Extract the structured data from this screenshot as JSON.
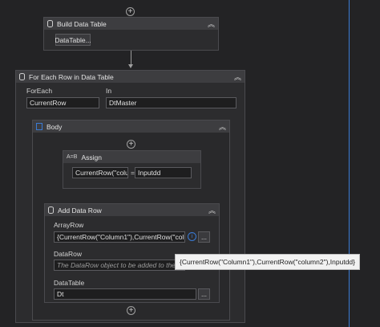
{
  "build_data_table": {
    "title": "Build Data Table",
    "button_label": "DataTable..."
  },
  "for_each_row": {
    "title": "For Each Row in Data Table",
    "foreach_label": "ForEach",
    "foreach_value": "CurrentRow",
    "in_label": "In",
    "in_value": "DtMaster"
  },
  "body_block": {
    "title": "Body"
  },
  "assign": {
    "title": "Assign",
    "to_value": "CurrentRow(\"colun",
    "equals": "=",
    "value": "Inputdd"
  },
  "add_data_row": {
    "title": "Add Data Row",
    "array_row_label": "ArrayRow",
    "array_row_value": "{CurrentRow(\"Column1\"),CurrentRow(\"column",
    "data_row_label": "DataRow",
    "data_row_placeholder": "The DataRow object to be added to the Dat",
    "data_table_label": "DataTable",
    "data_table_value": "Dt",
    "browse_label": "..."
  },
  "tooltip": {
    "text": "{CurrentRow(\"Column1\"),CurrentRow(\"column2\"),Inputdd}"
  },
  "colors": {
    "canvas": "#232325",
    "header": "#3d3d40",
    "accent_line": "#3a7bd5"
  },
  "icons": [
    "plus-circle-icon",
    "data-table-icon",
    "collapse-chevron-icon",
    "assign-icon",
    "expression-info-icon",
    "sequence-icon",
    "arrow-down-icon"
  ]
}
